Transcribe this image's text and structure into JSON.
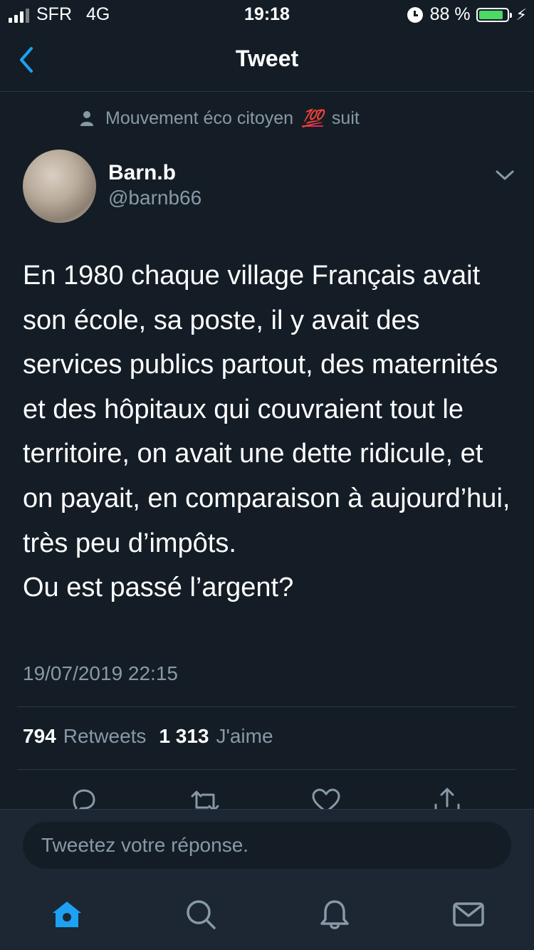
{
  "status_bar": {
    "carrier": "SFR",
    "network": "4G",
    "time": "19:18",
    "battery_percent": "88 %",
    "battery_level": 0.88,
    "icons": [
      "signal-icon",
      "alarm-icon",
      "battery-icon",
      "charging-bolt-icon"
    ]
  },
  "nav": {
    "title": "Tweet",
    "back_icon": "chevron-left-icon"
  },
  "context": {
    "prefix": "Mouvement éco citoyen",
    "emoji": "💯",
    "suffix": "suit"
  },
  "author": {
    "name": "Barn.b",
    "handle": "@barnb66"
  },
  "tweet": {
    "text": "En 1980 chaque village Français avait son école, sa poste, il y avait des services publics partout, des maternités et des hôpitaux qui couvraient tout le territoire, on avait une dette ridicule, et on payait, en comparaison à aujourd’hui, très peu d’impôts.\nOu est passé l’argent?",
    "date": "19/07/2019 22:15"
  },
  "stats": {
    "retweets_count": "794",
    "retweets_label": "Retweets",
    "likes_count": "1 313",
    "likes_label": "J'aime"
  },
  "actions": [
    "reply-icon",
    "retweet-icon",
    "like-icon",
    "share-icon"
  ],
  "reply": {
    "placeholder": "Tweetez votre réponse."
  },
  "tabs": [
    "home-icon",
    "search-icon",
    "notifications-icon",
    "messages-icon"
  ],
  "colors": {
    "background": "#141d26",
    "bar_background": "#1c2733",
    "secondary_text": "#8899a6",
    "accent": "#1da1f2",
    "battery": "#4cd964"
  }
}
